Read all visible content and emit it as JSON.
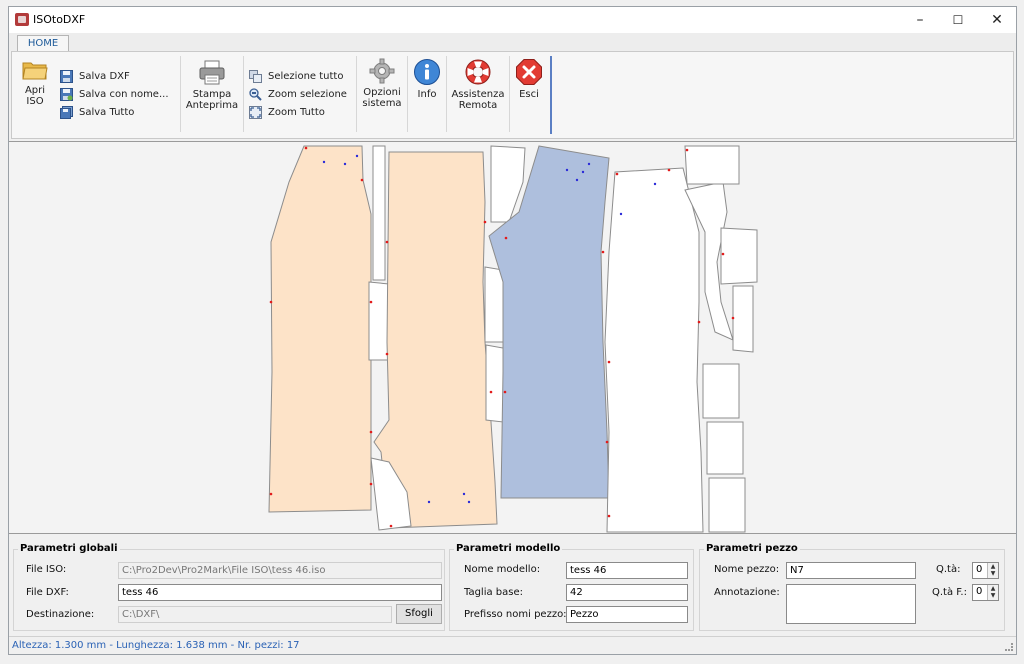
{
  "window": {
    "title": "ISOtoDXF",
    "minimize_glyph": "–",
    "maximize_glyph": "☐",
    "close_glyph": "✕"
  },
  "ribbon": {
    "tab": "HOME",
    "apri_line1": "Apri",
    "apri_line2": "ISO",
    "salva_dxf": "Salva DXF",
    "salva_con_nome": "Salva con nome...",
    "salva_tutto": "Salva Tutto",
    "stampa_line1": "Stampa",
    "stampa_line2": "Anteprima",
    "selezione_tutto": "Selezione tutto",
    "zoom_selezione": "Zoom selezione",
    "zoom_tutto": "Zoom Tutto",
    "opzioni_line1": "Opzioni",
    "opzioni_line2": "sistema",
    "info": "Info",
    "assistenza_line1": "Assistenza",
    "assistenza_line2": "Remota",
    "esci": "Esci",
    "icons": [
      "folder-icon",
      "save-icon",
      "save-as-icon",
      "save-all-icon",
      "printer-icon",
      "select-all-icon",
      "zoom-selection-icon",
      "zoom-all-icon",
      "gear-icon",
      "info-icon",
      "lifebuoy-icon",
      "exit-icon"
    ]
  },
  "parametri_globali": {
    "title": "Parametri globali",
    "file_iso_label": "File ISO:",
    "file_iso_value": "C:\\Pro2Dev\\Pro2Mark\\File ISO\\tess 46.iso",
    "file_dxf_label": "File DXF:",
    "file_dxf_value": "tess 46",
    "destinazione_label": "Destinazione:",
    "destinazione_value": "C:\\DXF\\",
    "sfogli_label": "Sfogli"
  },
  "parametri_modello": {
    "title": "Parametri modello",
    "nome_modello_label": "Nome modello:",
    "nome_modello_value": "tess 46",
    "taglia_base_label": "Taglia base:",
    "taglia_base_value": "42",
    "prefisso_label": "Prefisso nomi pezzo:",
    "prefisso_value": "Pezzo"
  },
  "parametri_pezzo": {
    "title": "Parametri pezzo",
    "nome_pezzo_label": "Nome pezzo:",
    "nome_pezzo_value": "N7",
    "annotazione_label": "Annotazione:",
    "annotazione_value": "",
    "qta_label": "Q.tà:",
    "qta_value": "0",
    "qtaf_label": "Q.tà F.:",
    "qtaf_value": "0"
  },
  "status": {
    "text": "Altezza: 1.300 mm - Lunghezza: 1.638 mm - Nr. pezzi: 17"
  },
  "colors": {
    "piece_orange": "#fde3c8",
    "piece_blue": "#aebfdd",
    "piece_outline": "#8c8c8c",
    "marker_red": "#e21b1b",
    "marker_blue": "#2b2bd8",
    "status_blue": "#2a62b5"
  }
}
